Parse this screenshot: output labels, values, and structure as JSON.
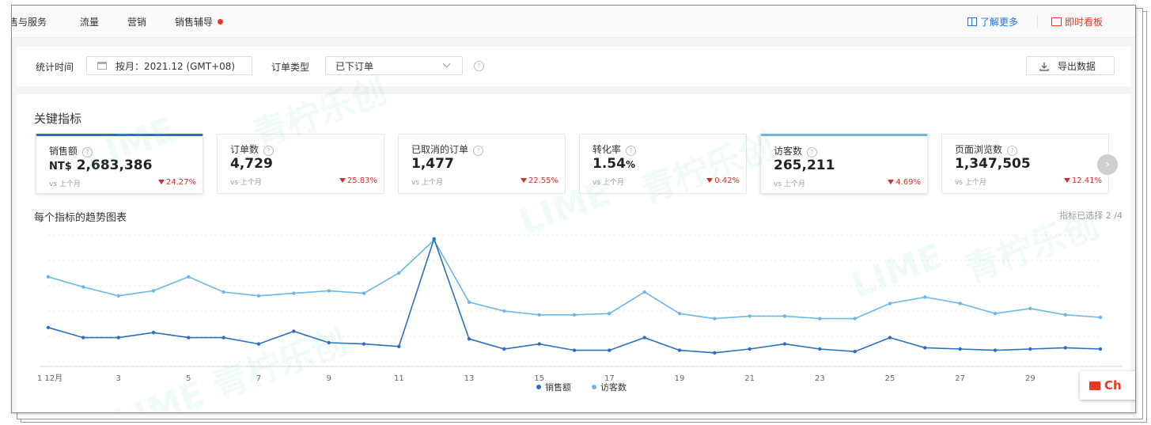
{
  "nav": {
    "items": [
      "售与服务",
      "流量",
      "营销",
      "销售辅导"
    ],
    "learn_more": "了解更多",
    "live_board": "即时看板"
  },
  "filters": {
    "time_label": "统计时间",
    "date_value": "按月：2021.12 (GMT+08)",
    "order_type_label": "订单类型",
    "order_type_value": "已下订单",
    "export_label": "导出数据"
  },
  "key_metrics": {
    "title": "关键指标",
    "cards": [
      {
        "title": "销售额",
        "prefix": "NT$",
        "value": "2,683,386",
        "suffix": "",
        "compare": "vs 上个月",
        "change": "24.27%",
        "selected": "primary"
      },
      {
        "title": "订单数",
        "prefix": "",
        "value": "4,729",
        "suffix": "",
        "compare": "vs 上个月",
        "change": "25.83%",
        "selected": "none"
      },
      {
        "title": "已取消的订单",
        "prefix": "",
        "value": "1,477",
        "suffix": "",
        "compare": "vs 上个月",
        "change": "22.55%",
        "selected": "none"
      },
      {
        "title": "转化率",
        "prefix": "",
        "value": "1.54",
        "suffix": "%",
        "compare": "vs 上个月",
        "change": "0.42%",
        "selected": "none"
      },
      {
        "title": "访客数",
        "prefix": "",
        "value": "265,211",
        "suffix": "",
        "compare": "vs 上个月",
        "change": "4.69%",
        "selected": "secondary"
      },
      {
        "title": "页面浏览数",
        "prefix": "",
        "value": "1,347,505",
        "suffix": "",
        "compare": "vs 上个月",
        "change": "12.41%",
        "selected": "none"
      }
    ],
    "next_icon": "chevron-right-icon",
    "change_color": "#d0302a"
  },
  "trend": {
    "title": "每个指标的趋势图表",
    "selected_count": "指标已选择 2 /4"
  },
  "chart_data": {
    "type": "line",
    "x": [
      1,
      2,
      3,
      4,
      5,
      6,
      7,
      8,
      9,
      10,
      11,
      12,
      13,
      14,
      15,
      16,
      17,
      18,
      19,
      20,
      21,
      22,
      23,
      24,
      25,
      26,
      27,
      28,
      29,
      30,
      31
    ],
    "x_tick_labels": [
      {
        "x": 1,
        "label": "1 12月"
      },
      {
        "x": 3,
        "label": "3"
      },
      {
        "x": 5,
        "label": "5"
      },
      {
        "x": 7,
        "label": "7"
      },
      {
        "x": 9,
        "label": "9"
      },
      {
        "x": 11,
        "label": "11"
      },
      {
        "x": 13,
        "label": "13"
      },
      {
        "x": 15,
        "label": "15"
      },
      {
        "x": 17,
        "label": "17"
      },
      {
        "x": 19,
        "label": "19"
      },
      {
        "x": 21,
        "label": "21"
      },
      {
        "x": 23,
        "label": "23"
      },
      {
        "x": 25,
        "label": "25"
      },
      {
        "x": 27,
        "label": "27"
      },
      {
        "x": 29,
        "label": "29"
      }
    ],
    "ylim": [
      0,
      100
    ],
    "grid": true,
    "legend": "bottom-center",
    "series": [
      {
        "name": "销售额",
        "color": "#2b6fc0",
        "values": [
          27,
          19,
          19,
          23,
          19,
          19,
          14,
          24,
          15,
          14,
          12,
          97,
          18,
          10,
          14,
          9,
          9,
          19,
          9,
          7,
          10,
          14,
          10,
          8,
          19,
          11,
          10,
          9,
          10,
          11,
          10
        ]
      },
      {
        "name": "访客数",
        "color": "#6ab7e8",
        "values": [
          67,
          59,
          52,
          56,
          67,
          55,
          52,
          54,
          56,
          54,
          70,
          96,
          47,
          40,
          37,
          37,
          38,
          55,
          38,
          34,
          36,
          36,
          34,
          34,
          46,
          51,
          46,
          38,
          42,
          37,
          35
        ]
      }
    ]
  },
  "chat": {
    "label": "Ch"
  }
}
